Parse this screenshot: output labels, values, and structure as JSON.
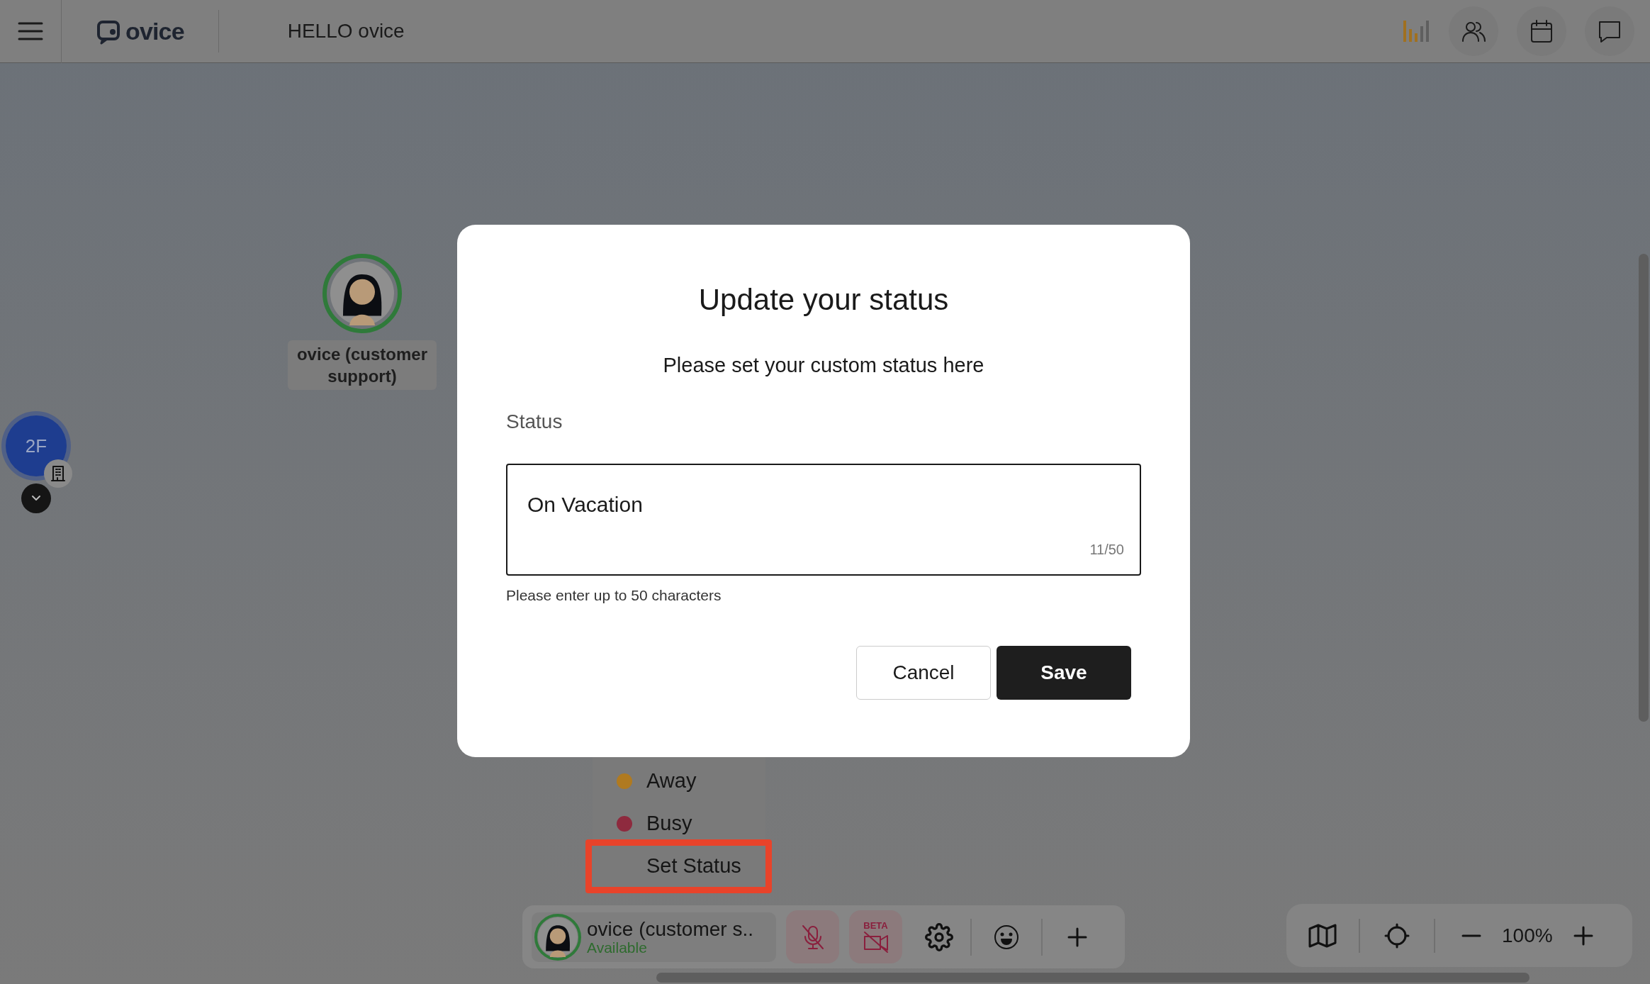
{
  "top_bar": {
    "logo": "ovice",
    "title": "HELLO ovice"
  },
  "floor": {
    "label": "2F"
  },
  "avatars": [
    {
      "name": "ovice (customer support)"
    }
  ],
  "status_menu": {
    "items": [
      {
        "label": "Away",
        "kind": "status",
        "color": "#b07a20",
        "highlighted": false
      },
      {
        "label": "Busy",
        "kind": "status",
        "color": "#8e2a3e",
        "highlighted": false
      },
      {
        "label": "Set Status",
        "kind": "action",
        "highlighted": true
      }
    ]
  },
  "dialog": {
    "title": "Update your status",
    "subtitle": "Please set your custom status here",
    "field_label": "Status",
    "status_field": {
      "value": "On Vacation",
      "counter": "11/50"
    },
    "hint": "Please enter up to 50 characters",
    "buttons": [
      {
        "label": "Cancel",
        "kind": "secondary"
      },
      {
        "label": "Save",
        "kind": "primary"
      }
    ]
  },
  "bottom_bar": {
    "user_name": "ovice (customer s..",
    "user_status": "Available",
    "camera_badge": "BETA"
  },
  "zoom_bar": {
    "level_text": "100%"
  }
}
